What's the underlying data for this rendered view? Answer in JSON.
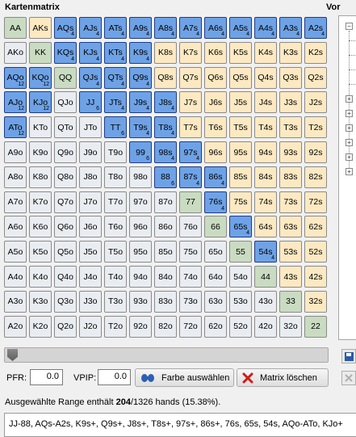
{
  "header": {
    "title": "Kartenmatrix",
    "side_title": "Vor"
  },
  "matrix": [
    [
      [
        "AA",
        "pair",
        ""
      ],
      [
        "AKs",
        "suited",
        ""
      ],
      [
        "AQs",
        "sel",
        "4"
      ],
      [
        "AJs",
        "sel",
        "4"
      ],
      [
        "ATs",
        "sel",
        "4"
      ],
      [
        "A9s",
        "sel",
        "4"
      ],
      [
        "A8s",
        "sel",
        "4"
      ],
      [
        "A7s",
        "sel",
        "4"
      ],
      [
        "A6s",
        "sel",
        "4"
      ],
      [
        "A5s",
        "sel",
        "4"
      ],
      [
        "A4s",
        "sel",
        "4"
      ],
      [
        "A3s",
        "sel",
        "4"
      ],
      [
        "A2s",
        "sel",
        "4"
      ]
    ],
    [
      [
        "AKo",
        "off",
        ""
      ],
      [
        "KK",
        "pair",
        ""
      ],
      [
        "KQs",
        "sel",
        "4"
      ],
      [
        "KJs",
        "sel",
        "4"
      ],
      [
        "KTs",
        "sel",
        "4"
      ],
      [
        "K9s",
        "sel",
        "4"
      ],
      [
        "K8s",
        "suited",
        ""
      ],
      [
        "K7s",
        "suited",
        ""
      ],
      [
        "K6s",
        "suited",
        ""
      ],
      [
        "K5s",
        "suited",
        ""
      ],
      [
        "K4s",
        "suited",
        ""
      ],
      [
        "K3s",
        "suited",
        ""
      ],
      [
        "K2s",
        "suited",
        ""
      ]
    ],
    [
      [
        "AQo",
        "sel",
        "12"
      ],
      [
        "KQo",
        "sel",
        "12"
      ],
      [
        "QQ",
        "pair",
        ""
      ],
      [
        "QJs",
        "sel",
        "4"
      ],
      [
        "QTs",
        "sel",
        "4"
      ],
      [
        "Q9s",
        "sel",
        "4"
      ],
      [
        "Q8s",
        "suited",
        ""
      ],
      [
        "Q7s",
        "suited",
        ""
      ],
      [
        "Q6s",
        "suited",
        ""
      ],
      [
        "Q5s",
        "suited",
        ""
      ],
      [
        "Q4s",
        "suited",
        ""
      ],
      [
        "Q3s",
        "suited",
        ""
      ],
      [
        "Q2s",
        "suited",
        ""
      ]
    ],
    [
      [
        "AJo",
        "sel",
        "12"
      ],
      [
        "KJo",
        "sel",
        "12"
      ],
      [
        "QJo",
        "off",
        ""
      ],
      [
        "JJ",
        "sel",
        "6"
      ],
      [
        "JTs",
        "sel",
        "4"
      ],
      [
        "J9s",
        "sel",
        "4"
      ],
      [
        "J8s",
        "sel",
        "4"
      ],
      [
        "J7s",
        "suited",
        ""
      ],
      [
        "J6s",
        "suited",
        ""
      ],
      [
        "J5s",
        "suited",
        ""
      ],
      [
        "J4s",
        "suited",
        ""
      ],
      [
        "J3s",
        "suited",
        ""
      ],
      [
        "J2s",
        "suited",
        ""
      ]
    ],
    [
      [
        "ATo",
        "sel",
        "12"
      ],
      [
        "KTo",
        "off",
        ""
      ],
      [
        "QTo",
        "off",
        ""
      ],
      [
        "JTo",
        "off",
        ""
      ],
      [
        "TT",
        "sel",
        "6"
      ],
      [
        "T9s",
        "sel",
        "4"
      ],
      [
        "T8s",
        "sel",
        "4"
      ],
      [
        "T7s",
        "suited",
        ""
      ],
      [
        "T6s",
        "suited",
        ""
      ],
      [
        "T5s",
        "suited",
        ""
      ],
      [
        "T4s",
        "suited",
        ""
      ],
      [
        "T3s",
        "suited",
        ""
      ],
      [
        "T2s",
        "suited",
        ""
      ]
    ],
    [
      [
        "A9o",
        "off",
        ""
      ],
      [
        "K9o",
        "off",
        ""
      ],
      [
        "Q9o",
        "off",
        ""
      ],
      [
        "J9o",
        "off",
        ""
      ],
      [
        "T9o",
        "off",
        ""
      ],
      [
        "99",
        "sel",
        "6"
      ],
      [
        "98s",
        "sel",
        "4"
      ],
      [
        "97s",
        "sel",
        "4"
      ],
      [
        "96s",
        "suited",
        ""
      ],
      [
        "95s",
        "suited",
        ""
      ],
      [
        "94s",
        "suited",
        ""
      ],
      [
        "93s",
        "suited",
        ""
      ],
      [
        "92s",
        "suited",
        ""
      ]
    ],
    [
      [
        "A8o",
        "off",
        ""
      ],
      [
        "K8o",
        "off",
        ""
      ],
      [
        "Q8o",
        "off",
        ""
      ],
      [
        "J8o",
        "off",
        ""
      ],
      [
        "T8o",
        "off",
        ""
      ],
      [
        "98o",
        "off",
        ""
      ],
      [
        "88",
        "sel",
        "6"
      ],
      [
        "87s",
        "sel",
        "4"
      ],
      [
        "86s",
        "sel",
        "4"
      ],
      [
        "85s",
        "suited",
        ""
      ],
      [
        "84s",
        "suited",
        ""
      ],
      [
        "83s",
        "suited",
        ""
      ],
      [
        "82s",
        "suited",
        ""
      ]
    ],
    [
      [
        "A7o",
        "off",
        ""
      ],
      [
        "K7o",
        "off",
        ""
      ],
      [
        "Q7o",
        "off",
        ""
      ],
      [
        "J7o",
        "off",
        ""
      ],
      [
        "T7o",
        "off",
        ""
      ],
      [
        "97o",
        "off",
        ""
      ],
      [
        "87o",
        "off",
        ""
      ],
      [
        "77",
        "pair",
        ""
      ],
      [
        "76s",
        "sel",
        "4"
      ],
      [
        "75s",
        "suited",
        ""
      ],
      [
        "74s",
        "suited",
        ""
      ],
      [
        "73s",
        "suited",
        ""
      ],
      [
        "72s",
        "suited",
        ""
      ]
    ],
    [
      [
        "A6o",
        "off",
        ""
      ],
      [
        "K6o",
        "off",
        ""
      ],
      [
        "Q6o",
        "off",
        ""
      ],
      [
        "J6o",
        "off",
        ""
      ],
      [
        "T6o",
        "off",
        ""
      ],
      [
        "96o",
        "off",
        ""
      ],
      [
        "86o",
        "off",
        ""
      ],
      [
        "76o",
        "off",
        ""
      ],
      [
        "66",
        "pair",
        ""
      ],
      [
        "65s",
        "sel",
        "4"
      ],
      [
        "64s",
        "suited",
        ""
      ],
      [
        "63s",
        "suited",
        ""
      ],
      [
        "62s",
        "suited",
        ""
      ]
    ],
    [
      [
        "A5o",
        "off",
        ""
      ],
      [
        "K5o",
        "off",
        ""
      ],
      [
        "Q5o",
        "off",
        ""
      ],
      [
        "J5o",
        "off",
        ""
      ],
      [
        "T5o",
        "off",
        ""
      ],
      [
        "95o",
        "off",
        ""
      ],
      [
        "85o",
        "off",
        ""
      ],
      [
        "75o",
        "off",
        ""
      ],
      [
        "65o",
        "off",
        ""
      ],
      [
        "55",
        "pair",
        ""
      ],
      [
        "54s",
        "sel",
        "4"
      ],
      [
        "53s",
        "suited",
        ""
      ],
      [
        "52s",
        "suited",
        ""
      ]
    ],
    [
      [
        "A4o",
        "off",
        ""
      ],
      [
        "K4o",
        "off",
        ""
      ],
      [
        "Q4o",
        "off",
        ""
      ],
      [
        "J4o",
        "off",
        ""
      ],
      [
        "T4o",
        "off",
        ""
      ],
      [
        "94o",
        "off",
        ""
      ],
      [
        "84o",
        "off",
        ""
      ],
      [
        "74o",
        "off",
        ""
      ],
      [
        "64o",
        "off",
        ""
      ],
      [
        "54o",
        "off",
        ""
      ],
      [
        "44",
        "pair",
        ""
      ],
      [
        "43s",
        "suited",
        ""
      ],
      [
        "42s",
        "suited",
        ""
      ]
    ],
    [
      [
        "A3o",
        "off",
        ""
      ],
      [
        "K3o",
        "off",
        ""
      ],
      [
        "Q3o",
        "off",
        ""
      ],
      [
        "J3o",
        "off",
        ""
      ],
      [
        "T3o",
        "off",
        ""
      ],
      [
        "93o",
        "off",
        ""
      ],
      [
        "83o",
        "off",
        ""
      ],
      [
        "73o",
        "off",
        ""
      ],
      [
        "63o",
        "off",
        ""
      ],
      [
        "53o",
        "off",
        ""
      ],
      [
        "43o",
        "off",
        ""
      ],
      [
        "33",
        "pair",
        ""
      ],
      [
        "32s",
        "suited",
        ""
      ]
    ],
    [
      [
        "A2o",
        "off",
        ""
      ],
      [
        "K2o",
        "off",
        ""
      ],
      [
        "Q2o",
        "off",
        ""
      ],
      [
        "J2o",
        "off",
        ""
      ],
      [
        "T2o",
        "off",
        ""
      ],
      [
        "92o",
        "off",
        ""
      ],
      [
        "82o",
        "off",
        ""
      ],
      [
        "72o",
        "off",
        ""
      ],
      [
        "62o",
        "off",
        ""
      ],
      [
        "52o",
        "off",
        ""
      ],
      [
        "42o",
        "off",
        ""
      ],
      [
        "32o",
        "off",
        ""
      ],
      [
        "22",
        "pair",
        ""
      ]
    ]
  ],
  "colors": {
    "pair": "#c9dcc1",
    "suited": "#fce9c2",
    "offsuit": "#e9edf2",
    "selected": "#6ea2e6"
  },
  "controls": {
    "pfr_label": "PFR:",
    "pfr_value": "0.0",
    "vpip_label": "VPIP:",
    "vpip_value": "0.0",
    "color_button": "Farbe auswählen",
    "clear_button": "Matrix löschen"
  },
  "summary": {
    "prefix": "Ausgewählte Range enthält ",
    "selected": "204",
    "suffix": "/1326 hands (15.38%)."
  },
  "range_text": "JJ-88, AQs-A2s, K9s+, Q9s+, J8s+, T8s+, 97s+, 86s+, 76s, 65s, 54s, AQo-ATo, KJo+"
}
